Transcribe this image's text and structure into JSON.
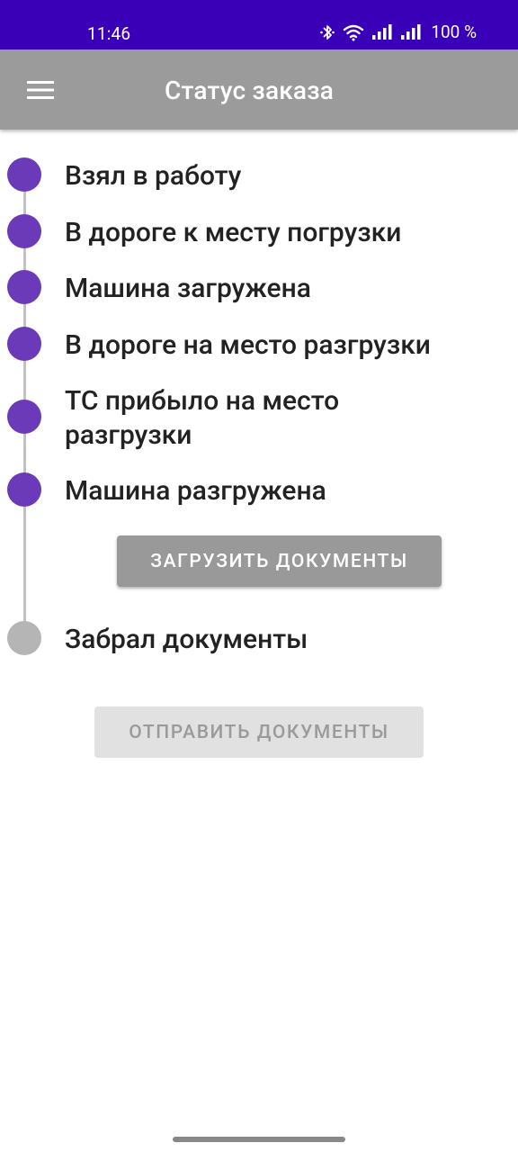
{
  "status_bar": {
    "time": "11:46",
    "battery": "100 %",
    "icons": [
      "bluetooth-icon",
      "wifi-icon",
      "signal-icon",
      "signal-icon"
    ]
  },
  "app_bar": {
    "title": "Статус заказа",
    "menu_icon": "hamburger-menu-icon",
    "background": "#9b9b9b"
  },
  "steps": [
    {
      "label": "Взял в работу",
      "done": true
    },
    {
      "label": "В дороге к месту погрузки",
      "done": true
    },
    {
      "label": "Машина загружена",
      "done": true
    },
    {
      "label": "В дороге на место разгрузки",
      "done": true
    },
    {
      "label": "ТС прибыло на место разгрузки",
      "done": true
    },
    {
      "label": "Машина разгружена",
      "done": true
    },
    {
      "label": "Забрал документы",
      "done": false
    }
  ],
  "buttons": {
    "upload_documents": "ЗАГРУЗИТЬ ДОКУМЕНТЫ",
    "send_documents": "ОТПРАВИТЬ ДОКУМЕНТЫ"
  },
  "colors": {
    "status_bar": "#3a00b7",
    "step_done": "#6a3ab8",
    "step_pending": "#b5b5b5"
  }
}
